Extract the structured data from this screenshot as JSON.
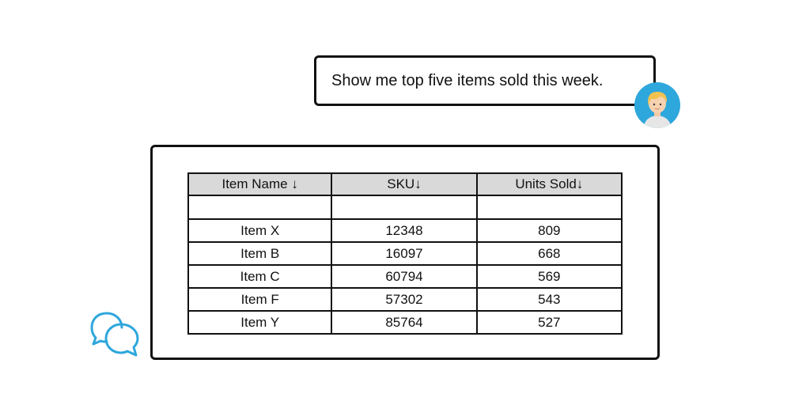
{
  "user_message": {
    "text": "Show me top five items sold this week."
  },
  "icons": {
    "user_avatar": "user-avatar-icon",
    "chat": "chat-bubbles-icon",
    "chat_color": "#2ea7dc",
    "avatar_bg": "#2ea7dc"
  },
  "table": {
    "headers": [
      "Item Name ↓",
      "SKU↓",
      "Units Sold↓"
    ],
    "header_bg": "#d9d9d9",
    "rows": [
      {
        "name": "Item X",
        "sku": "12348",
        "units": "809"
      },
      {
        "name": "Item B",
        "sku": "16097",
        "units": "668"
      },
      {
        "name": "Item C",
        "sku": "60794",
        "units": "569"
      },
      {
        "name": "Item F",
        "sku": "57302",
        "units": "543"
      },
      {
        "name": "Item Y",
        "sku": "85764",
        "units": "527"
      }
    ]
  }
}
